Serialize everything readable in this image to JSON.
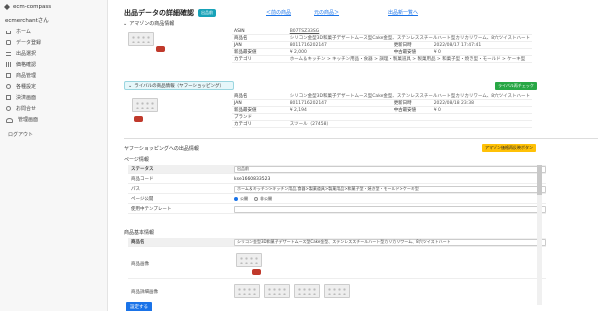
{
  "app": {
    "brand": "ecm-compass",
    "user": "ecmerchantさん"
  },
  "sidebar": {
    "items": [
      {
        "label": "ホーム",
        "icon": "home-icon"
      },
      {
        "label": "データ登録",
        "icon": "database-icon"
      },
      {
        "label": "出品選択",
        "icon": "list-icon"
      },
      {
        "label": "価格確認",
        "icon": "grid-icon"
      },
      {
        "label": "商品管理",
        "icon": "box-icon"
      },
      {
        "label": "各種設定",
        "icon": "gear-icon"
      },
      {
        "label": "決済画面",
        "icon": "card-icon"
      },
      {
        "label": "お問合せ",
        "icon": "help-icon"
      },
      {
        "label": "管理画面",
        "icon": "user-icon"
      }
    ],
    "logout": "ログアウト"
  },
  "header": {
    "title": "出品データの詳細確認",
    "badge": "出品前",
    "prev": "＜前の商品",
    "list": "元の商品＞",
    "new": "出品新一覧へ"
  },
  "amazon": {
    "heading": "アマゾンの商品情報",
    "rows": [
      {
        "k": "ASIN",
        "v": "B07TSZ33SG",
        "k2": "",
        "v2": ""
      },
      {
        "k": "商品名",
        "v": "シリコン金型3D和菓子デザートムース型Cake金型、ステンレススチールハート型カリカリワーム、8穴ツイストハート",
        "k2": "",
        "v2": ""
      },
      {
        "k": "JAN",
        "v": "8011716202147",
        "k2": "更新日時",
        "v2": "2022/08/17 17:47:41"
      },
      {
        "k": "新品最安値",
        "v": "¥ 2,000",
        "k2": "中古最安値",
        "v2": "¥ 0"
      },
      {
        "k": "カテゴリ",
        "v": "ホーム＆キッチン > キッチン用品・食器 > 調理・製菓道具 > 製菓用品 > 和菓子型・焼き型・モールド > ケーキ型",
        "k2": "",
        "v2": ""
      }
    ]
  },
  "rival": {
    "heading": "ライバルの商品情報（ヤフーショッピング）",
    "check_btn": "ライバル再チェック",
    "rows": [
      {
        "k": "商品名",
        "v": "シリコン金型3D和菓子デザートムース型Cake金型、ステンレススチールハート型カリカリワーム、8穴ツイストハート",
        "k2": "",
        "v2": ""
      },
      {
        "k": "JAN",
        "v": "8011716202147",
        "k2": "更新日時",
        "v2": "2022/08/18 23:38"
      },
      {
        "k": "新品最安値",
        "v": "¥ 2,194",
        "k2": "中古最安値",
        "v2": "¥ 0"
      },
      {
        "k": "ブランド",
        "v": "",
        "k2": "",
        "v2": ""
      },
      {
        "k": "カテゴリ",
        "v": "スツール（27458）",
        "k2": "",
        "v2": ""
      }
    ]
  },
  "yahoo": {
    "heading": "ヤフーショッピングへの出品情報",
    "reset_btn": "アマゾン価格再反映ボタン",
    "page_info": "ページ情報",
    "status_label": "ステータス",
    "status_value": "出品前",
    "code_label": "商品コード",
    "code_value": "kse1660833523",
    "path_label": "パス",
    "path_value": "ホーム＆キッチン>キッチン用品,食器>製菓道具>製菓用品>和菓子型・焼き型・モールド>ケーキ型",
    "publish_label": "ページ公開",
    "publish_on": "公開",
    "publish_off": "非公開",
    "template_label": "使用中テンプレート",
    "template_value": "",
    "basic_info": "商品基本情報",
    "name_label": "商品名",
    "name_value": "シリコン金型3D和菓子デザートムース型Cake金型、ステンレススチールハート型カリカリワーム、8穴ツイストハート",
    "image_label": "商品画像",
    "detail_image_label": "商品詳細画像",
    "submit": "設定する"
  }
}
